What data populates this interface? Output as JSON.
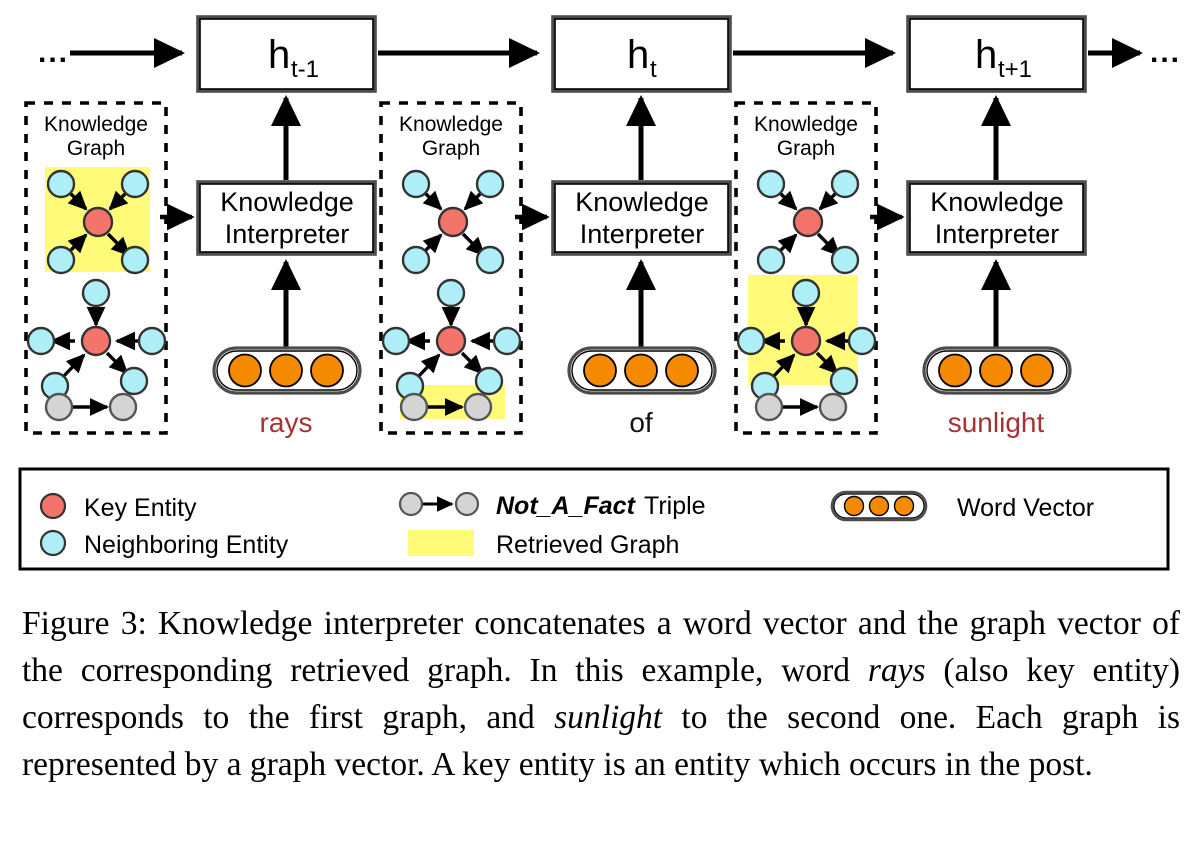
{
  "figure": {
    "timesteps": [
      {
        "hidden_label": "h",
        "hidden_sub": "t-1",
        "interpreter_line1": "Knowledge",
        "interpreter_line2": "Interpreter",
        "word": "rays",
        "word_color": "#a83232"
      },
      {
        "hidden_label": "h",
        "hidden_sub": "t",
        "interpreter_line1": "Knowledge",
        "interpreter_line2": "Interpreter",
        "word": "of",
        "word_color": "#111111"
      },
      {
        "hidden_label": "h",
        "hidden_sub": "t+1",
        "interpreter_line1": "Knowledge",
        "interpreter_line2": "Interpreter",
        "word": "sunlight",
        "word_color": "#a83232"
      }
    ],
    "knowledge_graphs": [
      {
        "title_line1": "Knowledge",
        "title_line2": "Graph",
        "highlighted": "x-graph"
      },
      {
        "title_line1": "Knowledge",
        "title_line2": "Graph",
        "highlighted": "triple"
      },
      {
        "title_line1": "Knowledge",
        "title_line2": "Graph",
        "highlighted": "star-graph"
      }
    ],
    "left_ellipsis": "...",
    "right_ellipsis": "..."
  },
  "legend": {
    "items": [
      {
        "icon": "key-entity-node",
        "label": "Key Entity"
      },
      {
        "icon": "neighboring-entity-node",
        "label": "Neighboring Entity"
      },
      {
        "icon": "not-a-fact-triple",
        "label_italic": "Not_A_Fact",
        "label": " Triple"
      },
      {
        "icon": "retrieved-graph-swatch",
        "label": "Retrieved Graph"
      },
      {
        "icon": "word-vector-capsule",
        "label": "Word Vector"
      }
    ]
  },
  "colors": {
    "key_entity": "#F4746C",
    "neighboring_entity": "#AEEFF7",
    "not_a_fact": "#D4D4D4",
    "retrieved_graph": "#FFFA78",
    "word_vector_dot": "#F58A00",
    "stroke": "#000000"
  },
  "caption": {
    "prefix": "Figure 3: Knowledge interpreter concatenates a word vector and the graph vector of the corresponding retrieved graph. In this example, word ",
    "italic1": "rays",
    "mid1": " (also key entity) corresponds to the first graph, and ",
    "italic2": "sunlight",
    "mid2": " to the second one. Each graph is represented by a graph vector. A key entity is an entity which occurs in the post."
  }
}
